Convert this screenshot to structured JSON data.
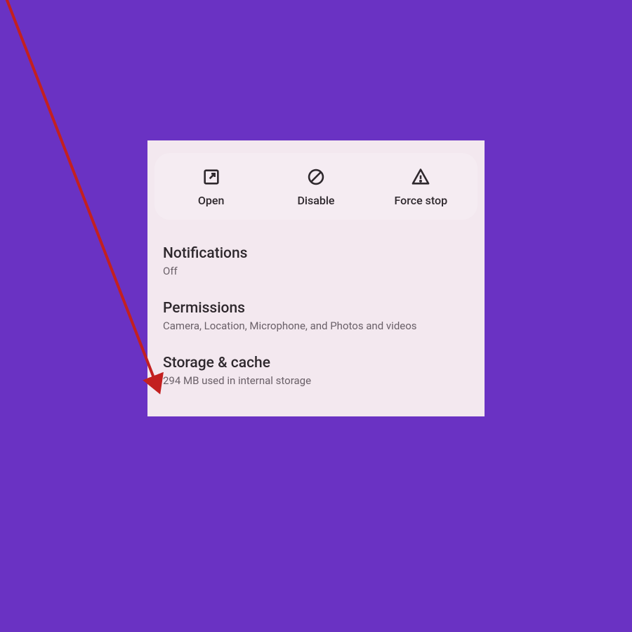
{
  "actions": {
    "open": "Open",
    "disable": "Disable",
    "forceStop": "Force stop"
  },
  "settings": {
    "notifications": {
      "title": "Notifications",
      "sub": "Off"
    },
    "permissions": {
      "title": "Permissions",
      "sub": "Camera, Location, Microphone, and Photos and videos"
    },
    "storage": {
      "title": "Storage & cache",
      "sub": "294 MB used in internal storage"
    }
  },
  "annotation": {
    "arrowColor": "#c32020"
  }
}
